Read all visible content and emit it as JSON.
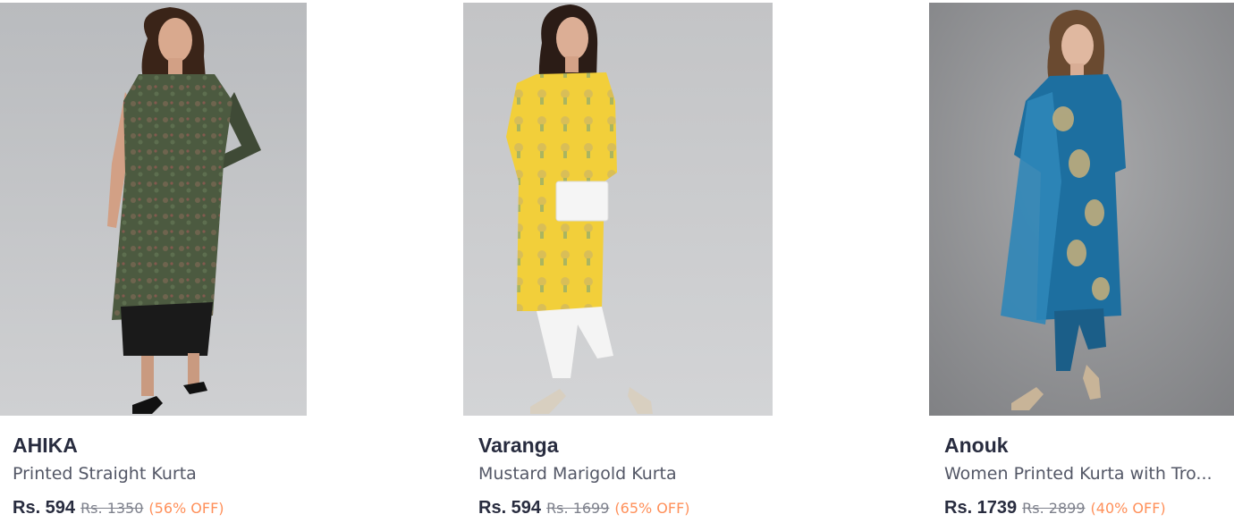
{
  "products": [
    {
      "brand": "AHIKA",
      "name": "Printed Straight Kurta",
      "price": "Rs. 594",
      "mrp": "Rs. 1350",
      "discount": "(56% OFF)",
      "image": "model-green-printed-kurta"
    },
    {
      "brand": "Varanga",
      "name": "Mustard Marigold Kurta",
      "price": "Rs. 594",
      "mrp": "Rs. 1699",
      "discount": "(65% OFF)",
      "image": "model-yellow-kurta-white-clutch"
    },
    {
      "brand": "Anouk",
      "name": "Women Printed Kurta with Tro...",
      "price": "Rs. 1739",
      "mrp": "Rs. 2899",
      "discount": "(40% OFF)",
      "image": "model-teal-kurta-with-dupatta"
    }
  ],
  "colors": {
    "brand_text": "#282c3f",
    "name_text": "#535766",
    "mrp_text": "#7e818c",
    "discount_text": "#ff905a"
  }
}
